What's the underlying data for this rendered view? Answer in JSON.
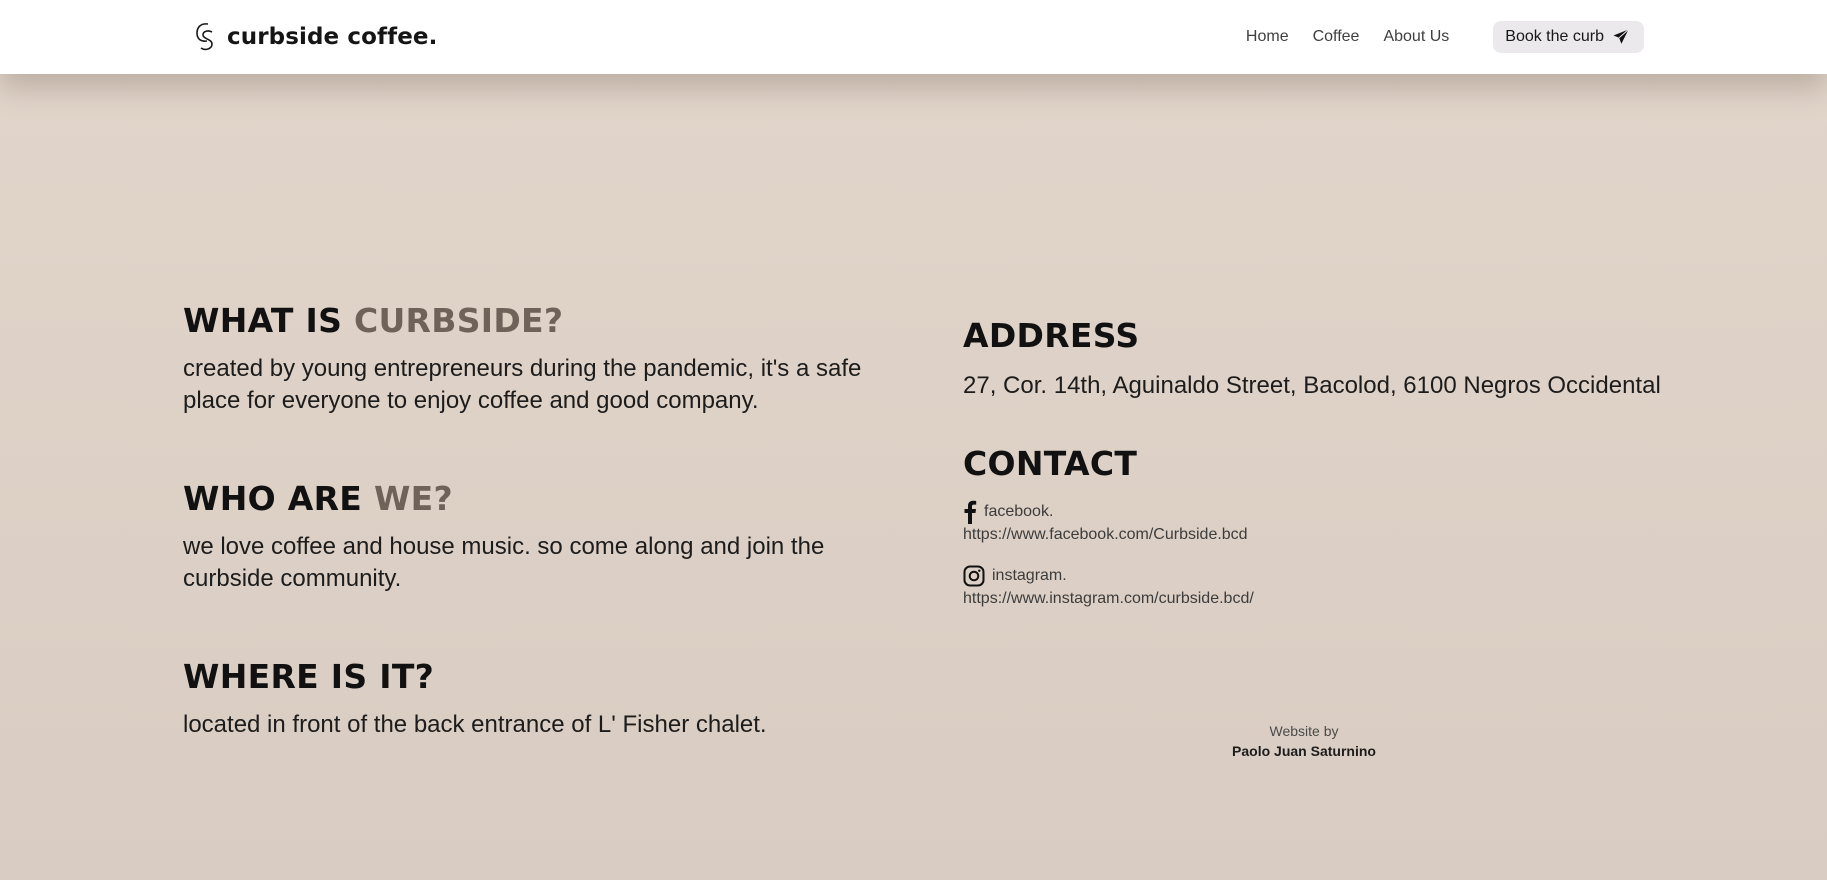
{
  "brand": {
    "name": "curbside coffee.",
    "logo_icon": "cs-monogram-logo"
  },
  "nav": {
    "links": [
      "Home",
      "Coffee",
      "About Us"
    ],
    "cta_label": "Book the curb",
    "cta_icon": "paper-plane-icon"
  },
  "about": [
    {
      "title": "WHAT IS",
      "accent": "CURBSIDE?",
      "text": "created by young entrepreneurs during the pandemic, it's a safe place for everyone to enjoy coffee and good company."
    },
    {
      "title": "WHO ARE",
      "accent": "WE?",
      "text": "we love coffee and house music. so come along and join the curbside community."
    },
    {
      "title": "WHERE IS IT?",
      "accent": "",
      "text": "located in front of the back entrance of L' Fisher chalet."
    }
  ],
  "address": {
    "title": "ADDRESS",
    "text": "27, Cor. 14th, Aguinaldo Street, Bacolod, 6100 Negros Occidental"
  },
  "contact": {
    "title": "CONTACT",
    "facebook": {
      "label": "facebook.",
      "url": "https://www.facebook.com/Curbside.bcd",
      "icon": "facebook-icon"
    },
    "instagram": {
      "label": "instagram.",
      "url": "https://www.instagram.com/curbside.bcd/",
      "icon": "instagram-icon"
    }
  },
  "credits": {
    "label": "Website by",
    "author": "Paolo Juan Saturnino"
  },
  "colors": {
    "background": "#ded2c8",
    "accent_text": "#6e6259",
    "button_bg": "#ebe9ec"
  }
}
